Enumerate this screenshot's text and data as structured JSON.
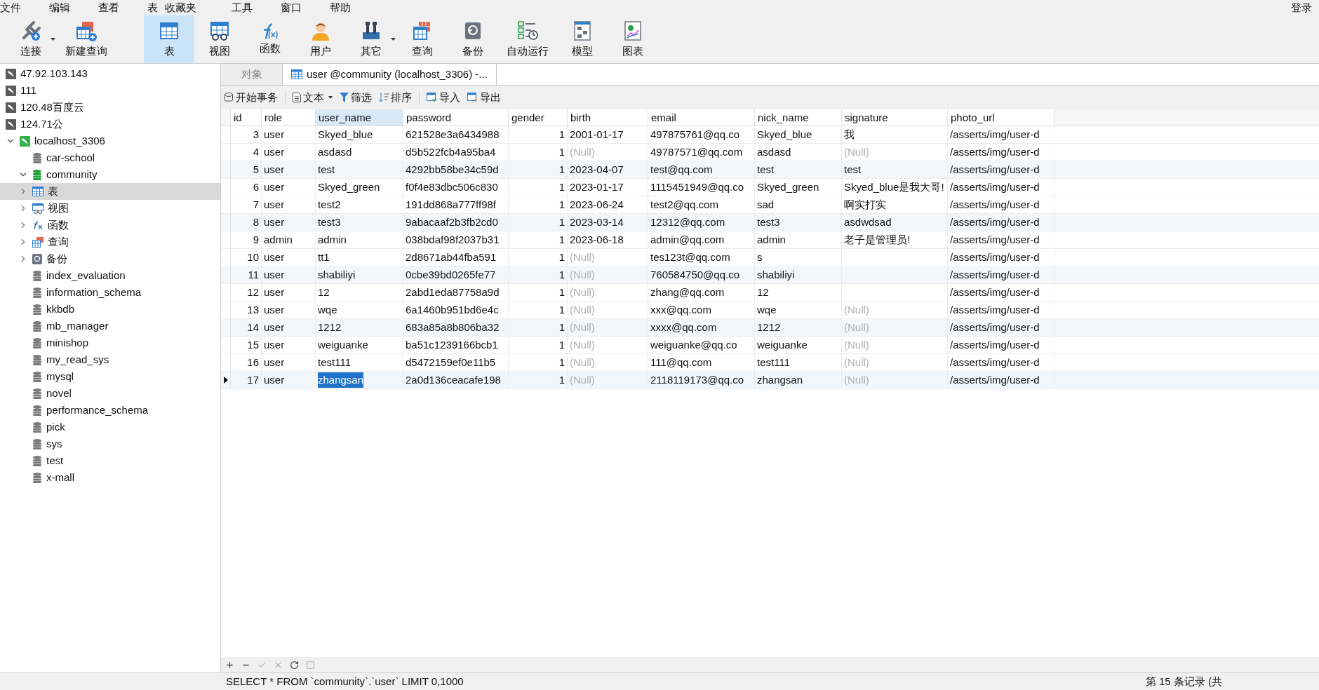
{
  "menu": [
    "文件",
    "编辑",
    "查看",
    "表",
    "收藏夹",
    "工具",
    "窗口",
    "帮助"
  ],
  "login": "登录",
  "toolbar": [
    {
      "kind": "connect",
      "label": "连接",
      "selected": false,
      "dropdown": true
    },
    {
      "kind": "new-query",
      "label": "新建查询",
      "selected": false,
      "dropdown": false
    },
    {
      "kind": "table",
      "label": "表",
      "selected": true,
      "dropdown": false
    },
    {
      "kind": "view",
      "label": "视图",
      "selected": false,
      "dropdown": false
    },
    {
      "kind": "function",
      "label": "函数",
      "selected": false,
      "dropdown": false
    },
    {
      "kind": "user",
      "label": "用户",
      "selected": false,
      "dropdown": false
    },
    {
      "kind": "other",
      "label": "其它",
      "selected": false,
      "dropdown": true
    },
    {
      "kind": "query",
      "label": "查询",
      "selected": false,
      "dropdown": false
    },
    {
      "kind": "backup",
      "label": "备份",
      "selected": false,
      "dropdown": false
    },
    {
      "kind": "schedule",
      "label": "自动运行",
      "selected": false,
      "dropdown": false
    },
    {
      "kind": "model",
      "label": "模型",
      "selected": false,
      "dropdown": false
    },
    {
      "kind": "chart",
      "label": "图表",
      "selected": false,
      "dropdown": false
    }
  ],
  "sidebar": [
    {
      "kind": "connection",
      "label": "47.92.103.143",
      "open": false,
      "selected": false
    },
    {
      "kind": "connection",
      "label": "111",
      "open": false,
      "selected": false
    },
    {
      "kind": "connection",
      "label": "120.48百度云",
      "open": false,
      "selected": false
    },
    {
      "kind": "connection",
      "label": "124.71公",
      "open": false,
      "selected": false
    },
    {
      "kind": "connection",
      "label": "localhost_3306",
      "open": true,
      "expanded": true,
      "selected": false,
      "children": [
        {
          "kind": "database",
          "label": "car-school",
          "open": false,
          "selected": false
        },
        {
          "kind": "database",
          "label": "community",
          "open": true,
          "expanded": true,
          "selected": false,
          "children": [
            {
              "kind": "table",
              "label": "表",
              "expanded": false,
              "selected": true
            },
            {
              "kind": "view",
              "label": "视图",
              "expanded": false,
              "selected": false
            },
            {
              "kind": "function",
              "label": "函数",
              "expanded": false,
              "selected": false
            },
            {
              "kind": "query",
              "label": "查询",
              "expanded": false,
              "selected": false
            },
            {
              "kind": "backup",
              "label": "备份",
              "expanded": false,
              "selected": false
            }
          ]
        },
        {
          "kind": "database",
          "label": "index_evaluation",
          "open": false,
          "selected": false
        },
        {
          "kind": "database",
          "label": "information_schema",
          "open": false,
          "selected": false
        },
        {
          "kind": "database",
          "label": "kkbdb",
          "open": false,
          "selected": false
        },
        {
          "kind": "database",
          "label": "mb_manager",
          "open": false,
          "selected": false
        },
        {
          "kind": "database",
          "label": "minishop",
          "open": false,
          "selected": false
        },
        {
          "kind": "database",
          "label": "my_read_sys",
          "open": false,
          "selected": false
        },
        {
          "kind": "database",
          "label": "mysql",
          "open": false,
          "selected": false
        },
        {
          "kind": "database",
          "label": "novel",
          "open": false,
          "selected": false
        },
        {
          "kind": "database",
          "label": "performance_schema",
          "open": false,
          "selected": false
        },
        {
          "kind": "database",
          "label": "pick",
          "open": false,
          "selected": false
        },
        {
          "kind": "database",
          "label": "sys",
          "open": false,
          "selected": false
        },
        {
          "kind": "database",
          "label": "test",
          "open": false,
          "selected": false
        },
        {
          "kind": "database",
          "label": "x-mall",
          "open": false,
          "selected": false
        }
      ]
    }
  ],
  "tabs": [
    {
      "kind": "plain",
      "label": "对象",
      "selected": false
    },
    {
      "kind": "table",
      "label": "user @community (localhost_3306) -...",
      "selected": true
    }
  ],
  "grid_toolbar": [
    {
      "kind": "transaction",
      "label": "开始事务",
      "dropdown": false
    },
    {
      "kind": "text",
      "label": "文本",
      "dropdown": true
    },
    {
      "kind": "filter",
      "label": "筛选",
      "dropdown": false
    },
    {
      "kind": "sort",
      "label": "排序",
      "dropdown": false
    },
    {
      "kind": "import",
      "label": "导入",
      "dropdown": false
    },
    {
      "kind": "export",
      "label": "导出",
      "dropdown": false
    }
  ],
  "table": {
    "columns": [
      {
        "label": "id",
        "selected": false,
        "kind": "number"
      },
      {
        "label": "role",
        "selected": false,
        "kind": "text"
      },
      {
        "label": "user_name",
        "selected": true,
        "kind": "text"
      },
      {
        "label": "password",
        "selected": false,
        "kind": "text"
      },
      {
        "label": "gender",
        "selected": false,
        "kind": "number"
      },
      {
        "label": "birth",
        "selected": false,
        "kind": "text"
      },
      {
        "label": "email",
        "selected": false,
        "kind": "text"
      },
      {
        "label": "nick_name",
        "selected": false,
        "kind": "text"
      },
      {
        "label": "signature",
        "selected": false,
        "kind": "text"
      },
      {
        "label": "photo_url",
        "selected": false,
        "kind": "text"
      }
    ],
    "rows": [
      {
        "current": false,
        "cells": [
          "3",
          "user",
          "Skyed_blue",
          "621528e3a6434988",
          "1",
          "2001-01-17",
          "497875761@qq.co",
          "Skyed_blue",
          "我",
          "/asserts/img/user-d"
        ]
      },
      {
        "current": false,
        "cells": [
          "4",
          "user",
          "asdasd",
          "d5b522fcb4a95ba4",
          "1",
          {
            "text": "(Null)",
            "null": true
          },
          "49787571@qq.com",
          "asdasd",
          {
            "text": "(Null)",
            "null": true
          },
          "/asserts/img/user-d"
        ]
      },
      {
        "current": false,
        "cells": [
          "5",
          "user",
          "test",
          "4292bb58be34c59d",
          "1",
          "2023-04-07",
          "test@qq.com",
          "test",
          "test",
          "/asserts/img/user-d"
        ]
      },
      {
        "current": false,
        "cells": [
          "6",
          "user",
          "Skyed_green",
          "f0f4e83dbc506c830",
          "1",
          "2023-01-17",
          "1115451949@qq.co",
          "Skyed_green",
          "Skyed_blue是我大哥!",
          "/asserts/img/user-d"
        ]
      },
      {
        "current": false,
        "cells": [
          "7",
          "user",
          "test2",
          "191dd868a777ff98f",
          "1",
          "2023-06-24",
          "test2@qq.com",
          "sad",
          "啊实打实",
          "/asserts/img/user-d"
        ]
      },
      {
        "current": false,
        "cells": [
          "8",
          "user",
          "test3",
          "9abacaaf2b3fb2cd0",
          "1",
          "2023-03-14",
          "12312@qq.com",
          "test3",
          "asdwdsad",
          "/asserts/img/user-d"
        ]
      },
      {
        "current": false,
        "cells": [
          "9",
          "admin",
          "admin",
          "038bdaf98f2037b31",
          "1",
          "2023-06-18",
          "admin@qq.com",
          "admin",
          "老子是管理员!",
          "/asserts/img/user-d"
        ]
      },
      {
        "current": false,
        "cells": [
          "10",
          "user",
          "tt1",
          "2d8671ab44fba591",
          "1",
          {
            "text": "(Null)",
            "null": true
          },
          "tes123t@qq.com",
          "s",
          "",
          "/asserts/img/user-d"
        ]
      },
      {
        "current": false,
        "cells": [
          "11",
          "user",
          "shabiliyi",
          "0cbe39bd0265fe77",
          "1",
          {
            "text": "(Null)",
            "null": true
          },
          "760584750@qq.co",
          "shabiliyi",
          "",
          "/asserts/img/user-d"
        ]
      },
      {
        "current": false,
        "cells": [
          "12",
          "user",
          "12",
          "2abd1eda87758a9d",
          "1",
          {
            "text": "(Null)",
            "null": true
          },
          "zhang@qq.com",
          "12",
          "",
          "/asserts/img/user-d"
        ]
      },
      {
        "current": false,
        "cells": [
          "13",
          "user",
          "wqe",
          "6a1460b951bd6e4c",
          "1",
          {
            "text": "(Null)",
            "null": true
          },
          "xxx@qq.com",
          "wqe",
          {
            "text": "(Null)",
            "null": true
          },
          "/asserts/img/user-d"
        ]
      },
      {
        "current": false,
        "cells": [
          "14",
          "user",
          "1212",
          "683a85a8b806ba32",
          "1",
          {
            "text": "(Null)",
            "null": true
          },
          "xxxx@qq.com",
          "1212",
          {
            "text": "(Null)",
            "null": true
          },
          "/asserts/img/user-d"
        ]
      },
      {
        "current": false,
        "cells": [
          "15",
          "user",
          "weiguanke",
          "ba51c1239166bcb1",
          "1",
          {
            "text": "(Null)",
            "null": true
          },
          "weiguanke@qq.co",
          "weiguanke",
          {
            "text": "(Null)",
            "null": true
          },
          "/asserts/img/user-d"
        ]
      },
      {
        "current": false,
        "cells": [
          "16",
          "user",
          "test111",
          "d5472159ef0e11b5",
          "1",
          {
            "text": "(Null)",
            "null": true
          },
          "111@qq.com",
          "test111",
          {
            "text": "(Null)",
            "null": true
          },
          "/asserts/img/user-d"
        ]
      },
      {
        "current": true,
        "cells": [
          "17",
          "user",
          {
            "text": "zhangsan",
            "selected": true
          },
          "2a0d136ceacafe198",
          "1",
          {
            "text": "(Null)",
            "null": true
          },
          "2118119173@qq.co",
          "zhangsan",
          {
            "text": "(Null)",
            "null": true
          },
          "/asserts/img/user-d"
        ]
      }
    ]
  },
  "grid_nav": [
    {
      "kind": "add",
      "disabled": false
    },
    {
      "kind": "remove",
      "disabled": false
    },
    {
      "kind": "apply",
      "disabled": true
    },
    {
      "kind": "discard",
      "disabled": true
    },
    {
      "kind": "refresh",
      "disabled": false
    },
    {
      "kind": "stop",
      "disabled": true
    }
  ],
  "status_bar": {
    "sql": "SELECT * FROM `community`.`user` LIMIT 0,1000",
    "record": "第 15 条记录 (共"
  }
}
